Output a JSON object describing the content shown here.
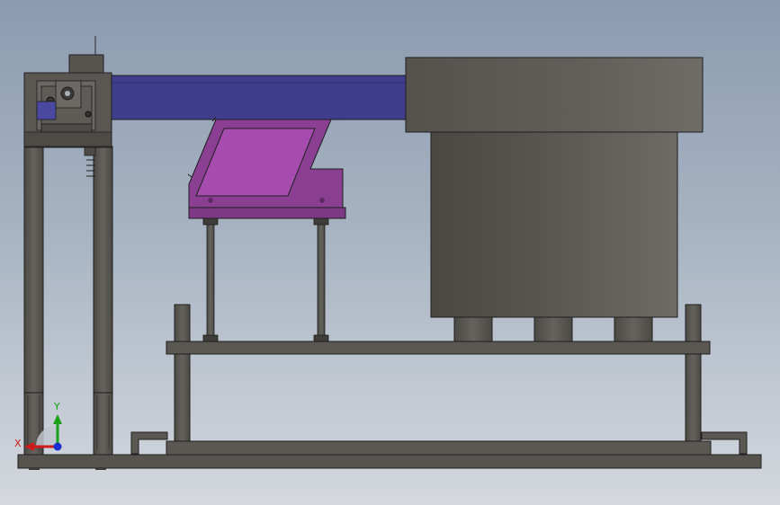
{
  "viewport": {
    "background_top": "#8c9bb0",
    "background_bottom": "#d4d8de"
  },
  "model": {
    "parts": [
      "base-plate",
      "left-frame-posts",
      "left-bearing-block",
      "horizontal-rail",
      "linear-track",
      "angled-chute",
      "chute-support-rods",
      "middle-platform",
      "vibratory-bowl",
      "bowl-feet",
      "guide-posts",
      "bottom-tray"
    ],
    "colors": {
      "steel": "#56534e",
      "steel_light": "#6e6b66",
      "rail_blue": "#3f3d8c",
      "chute_purple": "#8a3f93",
      "outline": "#1f1f1f"
    }
  },
  "triad": {
    "x_label": "X",
    "y_label": "Y",
    "x_color": "#d11a1a",
    "y_color": "#17a018",
    "z_color": "#1a2fd1"
  }
}
